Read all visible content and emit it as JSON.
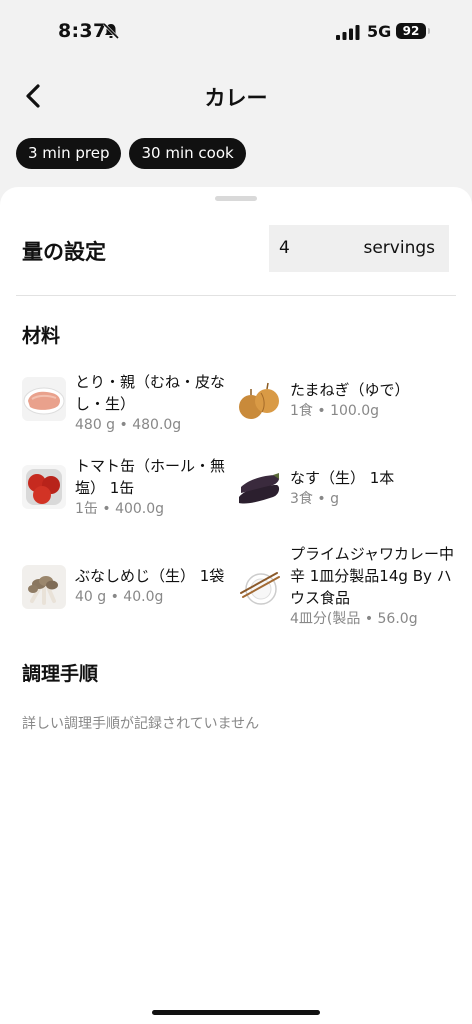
{
  "status": {
    "time": "8:37",
    "network": "5G",
    "battery": "92"
  },
  "header": {
    "title": "カレー"
  },
  "chips": [
    "3 min prep",
    "30 min cook"
  ],
  "quantity": {
    "label": "量の設定",
    "value": "4",
    "unit": "servings"
  },
  "ingredients_title": "材料",
  "ingredients": [
    {
      "name": "とり・親（むね・皮なし・生）",
      "amount": "480 g • 480.0g",
      "image": "chicken-breast-image"
    },
    {
      "name": "たまねぎ（ゆで）",
      "amount": "1食 • 100.0g",
      "image": "onion-image"
    },
    {
      "name": "トマト缶（ホール・無塩） 1缶",
      "amount": "1缶 • 400.0g",
      "image": "canned-tomato-image"
    },
    {
      "name": "なす（生） 1本",
      "amount": "3食 • g",
      "image": "eggplant-image"
    },
    {
      "name": "ぶなしめじ（生） 1袋",
      "amount": "40 g • 40.0g",
      "image": "shimeji-mushroom-image"
    },
    {
      "name": "プライムジャワカレー中辛 1皿分製品14g By ハウス食品",
      "amount": "4皿分(製品 • 56.0g",
      "image": "plate-chopsticks-image"
    }
  ],
  "steps": {
    "title": "調理手順",
    "empty": "詳しい調理手順が記録されていません"
  }
}
